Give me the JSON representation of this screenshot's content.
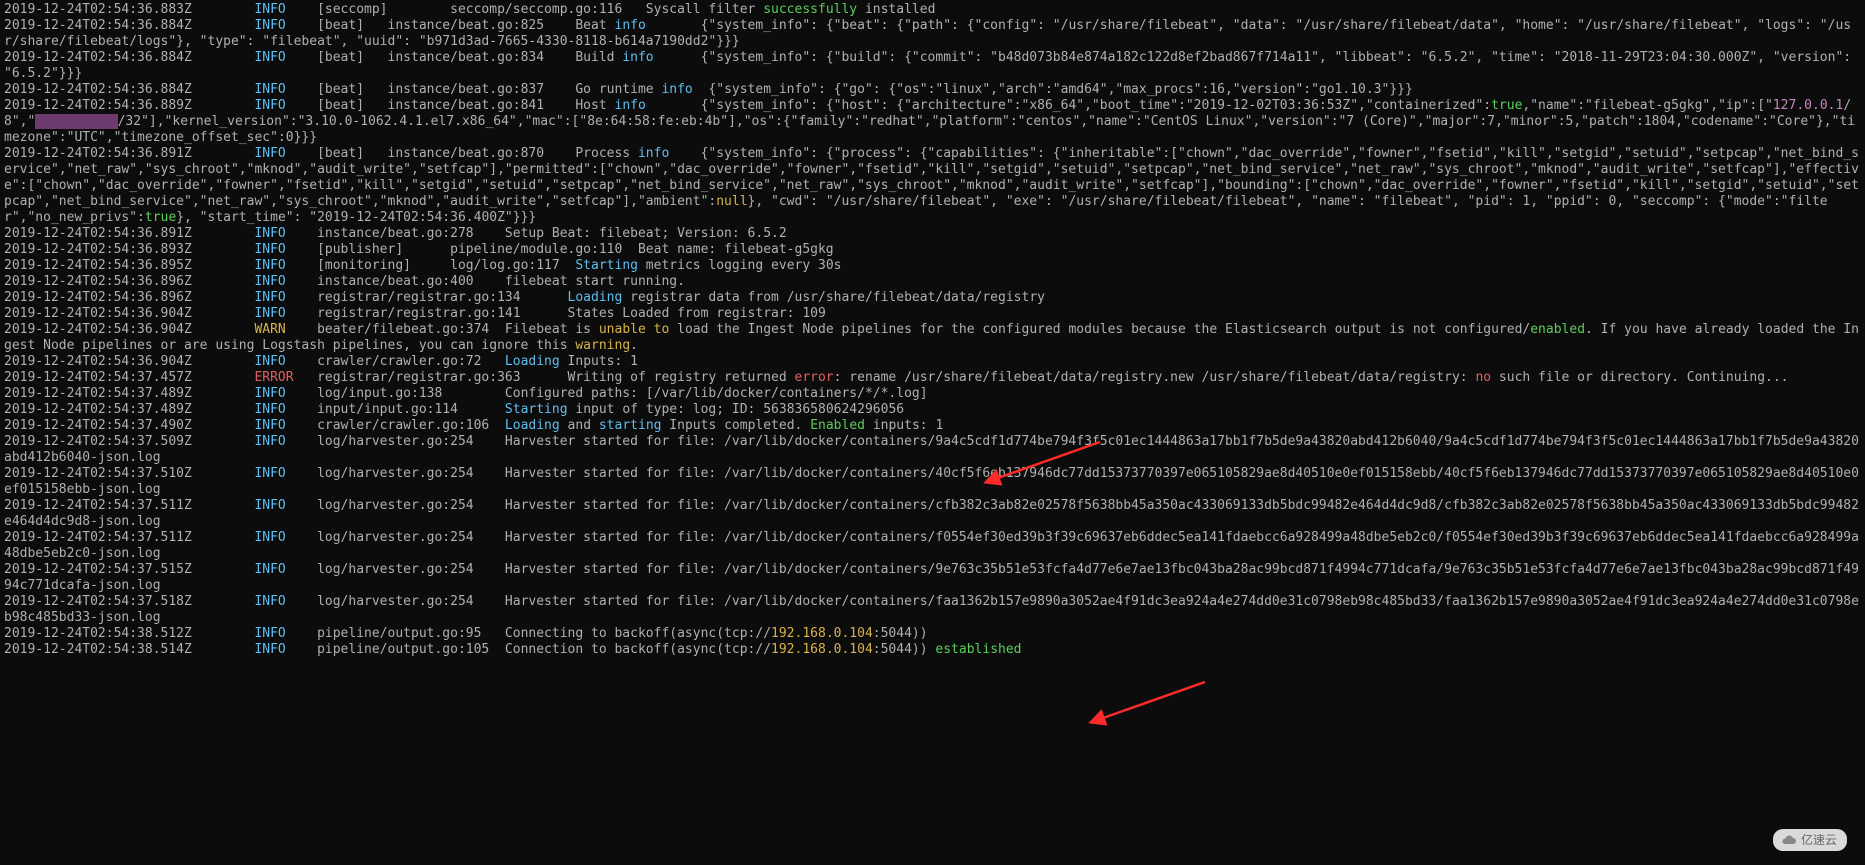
{
  "watermark": {
    "text": "亿速云"
  },
  "colors": {
    "info": "#5fbef0",
    "warn": "#d9b24a",
    "error": "#e06060",
    "green": "#5cce5c",
    "orange": "#d9b24a",
    "red": "#e06060",
    "purple": "#c586c0"
  },
  "lines": [
    [
      [
        "p",
        "2019-12-24T02:54:36.883Z        "
      ],
      [
        "info",
        "INFO"
      ],
      [
        "p",
        "    [seccomp]        seccomp/seccomp.go:116   Syscall filter "
      ],
      [
        "green",
        "successfully"
      ],
      [
        "p",
        " installed"
      ]
    ],
    [
      [
        "p",
        "2019-12-24T02:54:36.884Z        "
      ],
      [
        "info",
        "INFO"
      ],
      [
        "p",
        "    [beat]   instance/beat.go:825    Beat "
      ],
      [
        "info",
        "info"
      ],
      [
        "p",
        "       {\"system_info\": {\"beat\": {\"path\": {\"config\": \"/usr/share/filebeat\", \"data\": \"/usr/share/filebeat/data\", \"home\": \"/usr/share/filebeat\", \"logs\": \"/usr/share/filebeat/logs\"}, \"type\": \"filebeat\", \"uuid\": \"b971d3ad-7665-4330-8118-b614a7190dd2\"}}}"
      ]
    ],
    [
      [
        "p",
        "2019-12-24T02:54:36.884Z        "
      ],
      [
        "info",
        "INFO"
      ],
      [
        "p",
        "    [beat]   instance/beat.go:834    Build "
      ],
      [
        "info",
        "info"
      ],
      [
        "p",
        "      {\"system_info\": {\"build\": {\"commit\": \"b48d073b84e874a182c122d8ef2bad867f714a11\", \"libbeat\": \"6.5.2\", \"time\": \"2018-11-29T23:04:30.000Z\", \"version\": \"6.5.2\"}}}"
      ]
    ],
    [
      [
        "p",
        "2019-12-24T02:54:36.884Z        "
      ],
      [
        "info",
        "INFO"
      ],
      [
        "p",
        "    [beat]   instance/beat.go:837    Go runtime "
      ],
      [
        "info",
        "info"
      ],
      [
        "p",
        "  {\"system_info\": {\"go\": {\"os\":\"linux\",\"arch\":\"amd64\",\"max_procs\":16,\"version\":\"go1.10.3\"}}}"
      ]
    ],
    [
      [
        "p",
        "2019-12-24T02:54:36.889Z        "
      ],
      [
        "info",
        "INFO"
      ],
      [
        "p",
        "    [beat]   instance/beat.go:841    Host "
      ],
      [
        "info",
        "info"
      ],
      [
        "p",
        "       {\"system_info\": {\"host\": {\"architecture\":\"x86_64\",\"boot_time\":\"2019-12-02T03:36:53Z\",\"containerized\":"
      ],
      [
        "green",
        "true"
      ],
      [
        "p",
        ",\"name\":\"filebeat-g5gkg\",\"ip\":[\""
      ],
      [
        "purple",
        "127.0.0.1"
      ],
      [
        "p",
        "/8\",\""
      ],
      [
        "pink",
        "          "
      ],
      [
        "p",
        "/32\"],\"kernel_version\":\"3.10.0-1062.4.1.el7.x86_64\",\"mac\":[\"8e:64:58:fe:eb:4b\"],\"os\":{\"family\":\"redhat\",\"platform\":\"centos\",\"name\":\"CentOS Linux\",\"version\":\"7 (Core)\",\"major\":7,\"minor\":5,\"patch\":1804,\"codename\":\"Core\"},\"timezone\":\"UTC\",\"timezone_offset_sec\":0}}}"
      ]
    ],
    [
      [
        "p",
        "2019-12-24T02:54:36.891Z        "
      ],
      [
        "info",
        "INFO"
      ],
      [
        "p",
        "    [beat]   instance/beat.go:870    Process "
      ],
      [
        "info",
        "info"
      ],
      [
        "p",
        "    {\"system_info\": {\"process\": {\"capabilities\": {\"inheritable\":[\"chown\",\"dac_override\",\"fowner\",\"fsetid\",\"kill\",\"setgid\",\"setuid\",\"setpcap\",\"net_bind_service\",\"net_raw\",\"sys_chroot\",\"mknod\",\"audit_write\",\"setfcap\"],\"permitted\":[\"chown\",\"dac_override\",\"fowner\",\"fsetid\",\"kill\",\"setgid\",\"setuid\",\"setpcap\",\"net_bind_service\",\"net_raw\",\"sys_chroot\",\"mknod\",\"audit_write\",\"setfcap\"],\"effective\":[\"chown\",\"dac_override\",\"fowner\",\"fsetid\",\"kill\",\"setgid\",\"setuid\",\"setpcap\",\"net_bind_service\",\"net_raw\",\"sys_chroot\",\"mknod\",\"audit_write\",\"setfcap\"],\"bounding\":[\"chown\",\"dac_override\",\"fowner\",\"fsetid\",\"kill\",\"setgid\",\"setuid\",\"setpcap\",\"net_bind_service\",\"net_raw\",\"sys_chroot\",\"mknod\",\"audit_write\",\"setfcap\"],\"ambient\":"
      ],
      [
        "orange",
        "null"
      ],
      [
        "p",
        "}, \"cwd\": \"/usr/share/filebeat\", \"exe\": \"/usr/share/filebeat/filebeat\", \"name\": \"filebeat\", \"pid\": 1, \"ppid\": 0, \"seccomp\": {\"mode\":\"filter\",\"no_new_privs\":"
      ],
      [
        "green",
        "true"
      ],
      [
        "p",
        "}, \"start_time\": \"2019-12-24T02:54:36.400Z\"}}}"
      ]
    ],
    [
      [
        "p",
        "2019-12-24T02:54:36.891Z        "
      ],
      [
        "info",
        "INFO"
      ],
      [
        "p",
        "    instance/beat.go:278    Setup Beat: filebeat; Version: 6.5.2"
      ]
    ],
    [
      [
        "p",
        "2019-12-24T02:54:36.893Z        "
      ],
      [
        "info",
        "INFO"
      ],
      [
        "p",
        "    [publisher]      pipeline/module.go:110  Beat name: filebeat-g5gkg"
      ]
    ],
    [
      [
        "p",
        "2019-12-24T02:54:36.895Z        "
      ],
      [
        "info",
        "INFO"
      ],
      [
        "p",
        "    [monitoring]     log/log.go:117  "
      ],
      [
        "info",
        "Starting"
      ],
      [
        "p",
        " metrics logging every 30s"
      ]
    ],
    [
      [
        "p",
        "2019-12-24T02:54:36.896Z        "
      ],
      [
        "info",
        "INFO"
      ],
      [
        "p",
        "    instance/beat.go:400    filebeat start running."
      ]
    ],
    [
      [
        "p",
        "2019-12-24T02:54:36.896Z        "
      ],
      [
        "info",
        "INFO"
      ],
      [
        "p",
        "    registrar/registrar.go:134      "
      ],
      [
        "info",
        "Loading"
      ],
      [
        "p",
        " registrar data from /usr/share/filebeat/data/registry"
      ]
    ],
    [
      [
        "p",
        "2019-12-24T02:54:36.904Z        "
      ],
      [
        "info",
        "INFO"
      ],
      [
        "p",
        "    registrar/registrar.go:141      States Loaded from registrar: 109"
      ]
    ],
    [
      [
        "p",
        "2019-12-24T02:54:36.904Z        "
      ],
      [
        "warn",
        "WARN"
      ],
      [
        "p",
        "    beater/filebeat.go:374  Filebeat is "
      ],
      [
        "orange",
        "unable to"
      ],
      [
        "p",
        " load the Ingest Node pipelines for the configured modules because the Elasticsearch output is not configured/"
      ],
      [
        "green",
        "enabled"
      ],
      [
        "p",
        ". If you have already loaded the Ingest Node pipelines or are using Logstash pipelines, you can ignore this "
      ],
      [
        "orange",
        "warning"
      ],
      [
        "p",
        "."
      ]
    ],
    [
      [
        "p",
        "2019-12-24T02:54:36.904Z        "
      ],
      [
        "info",
        "INFO"
      ],
      [
        "p",
        "    crawler/crawler.go:72   "
      ],
      [
        "info",
        "Loading"
      ],
      [
        "p",
        " Inputs: 1"
      ]
    ],
    [
      [
        "p",
        "2019-12-24T02:54:37.457Z        "
      ],
      [
        "error",
        "ERROR"
      ],
      [
        "p",
        "   registrar/registrar.go:363      Writing of registry returned "
      ],
      [
        "red",
        "error"
      ],
      [
        "p",
        ": rename /usr/share/filebeat/data/registry.new /usr/share/filebeat/data/registry: "
      ],
      [
        "red",
        "no"
      ],
      [
        "p",
        " such file or directory. Continuing..."
      ]
    ],
    [
      [
        "p",
        "2019-12-24T02:54:37.489Z        "
      ],
      [
        "info",
        "INFO"
      ],
      [
        "p",
        "    log/input.go:138        Configured paths: [/var/lib/docker/containers/*/*.log]"
      ]
    ],
    [
      [
        "p",
        "2019-12-24T02:54:37.489Z        "
      ],
      [
        "info",
        "INFO"
      ],
      [
        "p",
        "    input/input.go:114      "
      ],
      [
        "info",
        "Starting"
      ],
      [
        "p",
        " input of type: log; ID: 563836580624296056"
      ]
    ],
    [
      [
        "p",
        "2019-12-24T02:54:37.490Z        "
      ],
      [
        "info",
        "INFO"
      ],
      [
        "p",
        "    crawler/crawler.go:106  "
      ],
      [
        "info",
        "Loading"
      ],
      [
        "p",
        " and "
      ],
      [
        "info",
        "starting"
      ],
      [
        "p",
        " Inputs completed. "
      ],
      [
        "green",
        "Enabled"
      ],
      [
        "p",
        " inputs: 1"
      ]
    ],
    [
      [
        "p",
        "2019-12-24T02:54:37.509Z        "
      ],
      [
        "info",
        "INFO"
      ],
      [
        "p",
        "    log/harvester.go:254    Harvester started for file: /var/lib/docker/containers/9a4c5cdf1d774be794f3f5c01ec1444863a17bb1f7b5de9a43820abd412b6040/9a4c5cdf1d774be794f3f5c01ec1444863a17bb1f7b5de9a43820abd412b6040-json.log"
      ]
    ],
    [
      [
        "p",
        "2019-12-24T02:54:37.510Z        "
      ],
      [
        "info",
        "INFO"
      ],
      [
        "p",
        "    log/harvester.go:254    Harvester started for file: /var/lib/docker/containers/40cf5f6eb137946dc77dd15373770397e065105829ae8d40510e0ef015158ebb/40cf5f6eb137946dc77dd15373770397e065105829ae8d40510e0ef015158ebb-json.log"
      ]
    ],
    [
      [
        "p",
        "2019-12-24T02:54:37.511Z        "
      ],
      [
        "info",
        "INFO"
      ],
      [
        "p",
        "    log/harvester.go:254    Harvester started for file: /var/lib/docker/containers/cfb382c3ab82e02578f5638bb45a350ac433069133db5bdc99482e464d4dc9d8/cfb382c3ab82e02578f5638bb45a350ac433069133db5bdc99482e464d4dc9d8-json.log"
      ]
    ],
    [
      [
        "p",
        "2019-12-24T02:54:37.511Z        "
      ],
      [
        "info",
        "INFO"
      ],
      [
        "p",
        "    log/harvester.go:254    Harvester started for file: /var/lib/docker/containers/f0554ef30ed39b3f39c69637eb6ddec5ea141fdaebcc6a928499a48dbe5eb2c0/f0554ef30ed39b3f39c69637eb6ddec5ea141fdaebcc6a928499a48dbe5eb2c0-json.log"
      ]
    ],
    [
      [
        "p",
        "2019-12-24T02:54:37.515Z        "
      ],
      [
        "info",
        "INFO"
      ],
      [
        "p",
        "    log/harvester.go:254    Harvester started for file: /var/lib/docker/containers/9e763c35b51e53fcfa4d77e6e7ae13fbc043ba28ac99bcd871f4994c771dcafa/9e763c35b51e53fcfa4d77e6e7ae13fbc043ba28ac99bcd871f4994c771dcafa-json.log"
      ]
    ],
    [
      [
        "p",
        "2019-12-24T02:54:37.518Z        "
      ],
      [
        "info",
        "INFO"
      ],
      [
        "p",
        "    log/harvester.go:254    Harvester started for file: /var/lib/docker/containers/faa1362b157e9890a3052ae4f91dc3ea924a4e274dd0e31c0798eb98c485bd33/faa1362b157e9890a3052ae4f91dc3ea924a4e274dd0e31c0798eb98c485bd33-json.log"
      ]
    ],
    [
      [
        "p",
        "2019-12-24T02:54:38.512Z        "
      ],
      [
        "info",
        "INFO"
      ],
      [
        "p",
        "    pipeline/output.go:95   Connecting to backoff(async(tcp://"
      ],
      [
        "orange",
        "192.168.0.104"
      ],
      [
        "p",
        ":5044))"
      ]
    ],
    [
      [
        "p",
        "2019-12-24T02:54:38.514Z        "
      ],
      [
        "info",
        "INFO"
      ],
      [
        "p",
        "    pipeline/output.go:105  Connection to backoff(async(tcp://"
      ],
      [
        "orange",
        "192.168.0.104"
      ],
      [
        "p",
        ":5044)) "
      ],
      [
        "green",
        "established"
      ]
    ]
  ]
}
